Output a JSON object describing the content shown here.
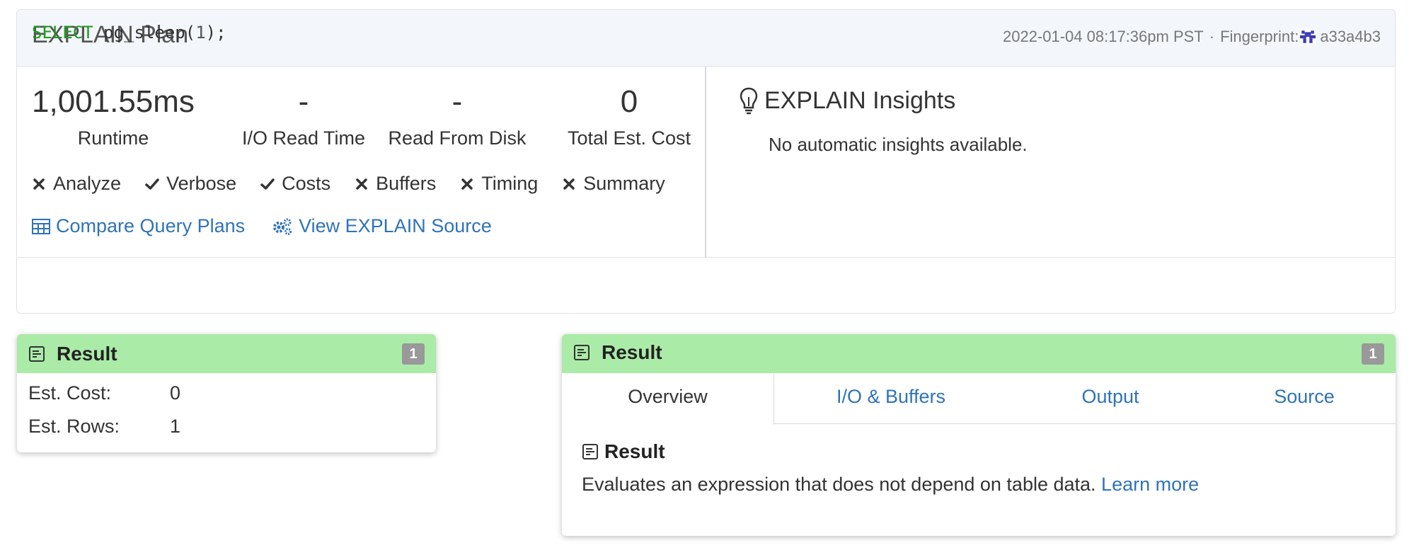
{
  "plan": {
    "title": "EXPLAIN Plan",
    "timestamp": "2022-01-04 08:17:36pm PST",
    "separator": "·",
    "fingerprint_label": "Fingerprint:",
    "fingerprint": "a33a4b3"
  },
  "stats": [
    {
      "value": "1,001.55ms",
      "label": "Runtime"
    },
    {
      "value": "-",
      "label": "I/O Read Time"
    },
    {
      "value": "-",
      "label": "Read From Disk"
    },
    {
      "value": "0",
      "label": "Total Est. Cost"
    }
  ],
  "options": [
    {
      "label": "Analyze",
      "enabled": false
    },
    {
      "label": "Verbose",
      "enabled": true
    },
    {
      "label": "Costs",
      "enabled": true
    },
    {
      "label": "Buffers",
      "enabled": false
    },
    {
      "label": "Timing",
      "enabled": false
    },
    {
      "label": "Summary",
      "enabled": false
    }
  ],
  "links": {
    "compare": "Compare Query Plans",
    "source": "View EXPLAIN Source"
  },
  "insights": {
    "title": "EXPLAIN Insights",
    "message": "No automatic insights available."
  },
  "query": {
    "keyword": "SELECT",
    "fn": " pg_sleep(",
    "arg": "1",
    "end": ");"
  },
  "node": {
    "title": "Result",
    "badge": "1",
    "cost_label": "Est. Cost:",
    "cost_value": "0",
    "rows_label": "Est. Rows:",
    "rows_value": "1"
  },
  "detail": {
    "title": "Result",
    "badge": "1",
    "tabs": [
      "Overview",
      "I/O & Buffers",
      "Output",
      "Source"
    ],
    "section_title": "Result",
    "description": "Evaluates an expression that does not depend on table data. ",
    "learn_more": "Learn more"
  },
  "colors": {
    "accent": "#2f73b7",
    "node_header": "#abeba8",
    "keyword": "#1a9a1a"
  }
}
